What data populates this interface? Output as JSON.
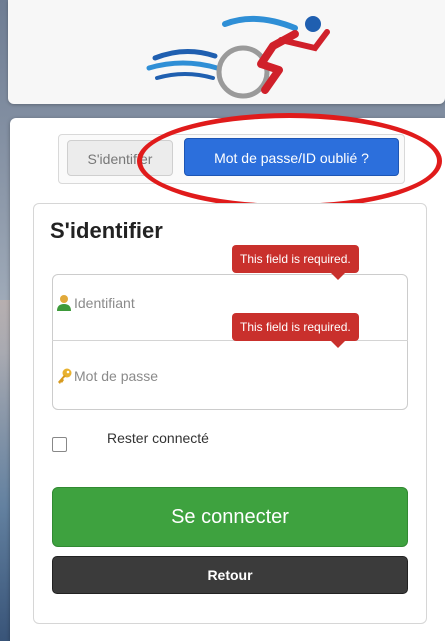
{
  "header": {
    "logo_icon": "cyclist-logo-icon"
  },
  "tabs": {
    "login_label": "S'identifier",
    "forgot_label": "Mot de passe/ID oublié ?"
  },
  "form": {
    "title": "S'identifier",
    "username_placeholder": "Identifiant",
    "password_placeholder": "Mot de passe",
    "username_error": "This field is required.",
    "password_error": "This field is required.",
    "remember_label": "Rester connecté",
    "remember_checked": false,
    "connect_label": "Se connecter",
    "back_label": "Retour"
  },
  "colors": {
    "primary_blue": "#2c6fdc",
    "success_green": "#3ea23f",
    "error_red": "#c9302c",
    "annotation_red": "#e01b1b"
  }
}
